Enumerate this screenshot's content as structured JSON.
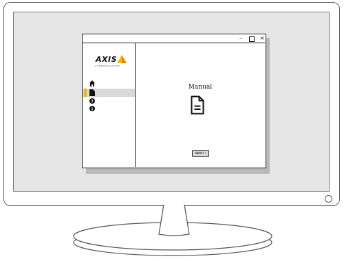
{
  "window": {
    "controls": {
      "minimize": "–",
      "maximize": "",
      "close": "×"
    }
  },
  "logo": {
    "name": "AXIS",
    "tagline": "COMMUNICATIONS",
    "accent_color": "#f5b800"
  },
  "sidebar": {
    "items": [
      {
        "icon": "home-icon",
        "active": false
      },
      {
        "icon": "document-icon",
        "active": true
      },
      {
        "icon": "help-icon",
        "active": false
      },
      {
        "icon": "info-icon",
        "active": false
      }
    ]
  },
  "main": {
    "title": "Manual",
    "icon": "document-icon",
    "open_button_label": "open ›"
  },
  "colors": {
    "screen_bg": "#e6e6e6",
    "active_item_bg": "#d9d9d9",
    "accent": "#f5b800"
  }
}
